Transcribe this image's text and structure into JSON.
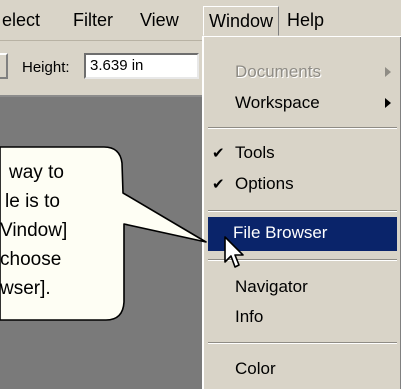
{
  "menubar": {
    "items": [
      "elect",
      "Filter",
      "View",
      "Window",
      "Help"
    ]
  },
  "options": {
    "height_label": "Height:",
    "height_value": "3.639 in"
  },
  "window_menu": {
    "items": [
      {
        "label": "Documents",
        "disabled": true,
        "submenu": true
      },
      {
        "label": "Workspace",
        "disabled": false,
        "submenu": true
      },
      {
        "label": "Tools",
        "checked": true
      },
      {
        "label": "Options",
        "checked": true
      },
      {
        "label": "File Browser",
        "highlighted": true
      },
      {
        "label": "Navigator"
      },
      {
        "label": "Info"
      },
      {
        "label": "Color"
      }
    ],
    "check_glyph": "✔"
  },
  "callout": {
    "lines": [
      "way to",
      "le is to",
      "Vindow]",
      " choose",
      "wser]."
    ]
  },
  "icons": {
    "cursor": "arrow-pointer-icon",
    "check": "checkmark-icon",
    "submenu": "triangle-right-icon"
  }
}
